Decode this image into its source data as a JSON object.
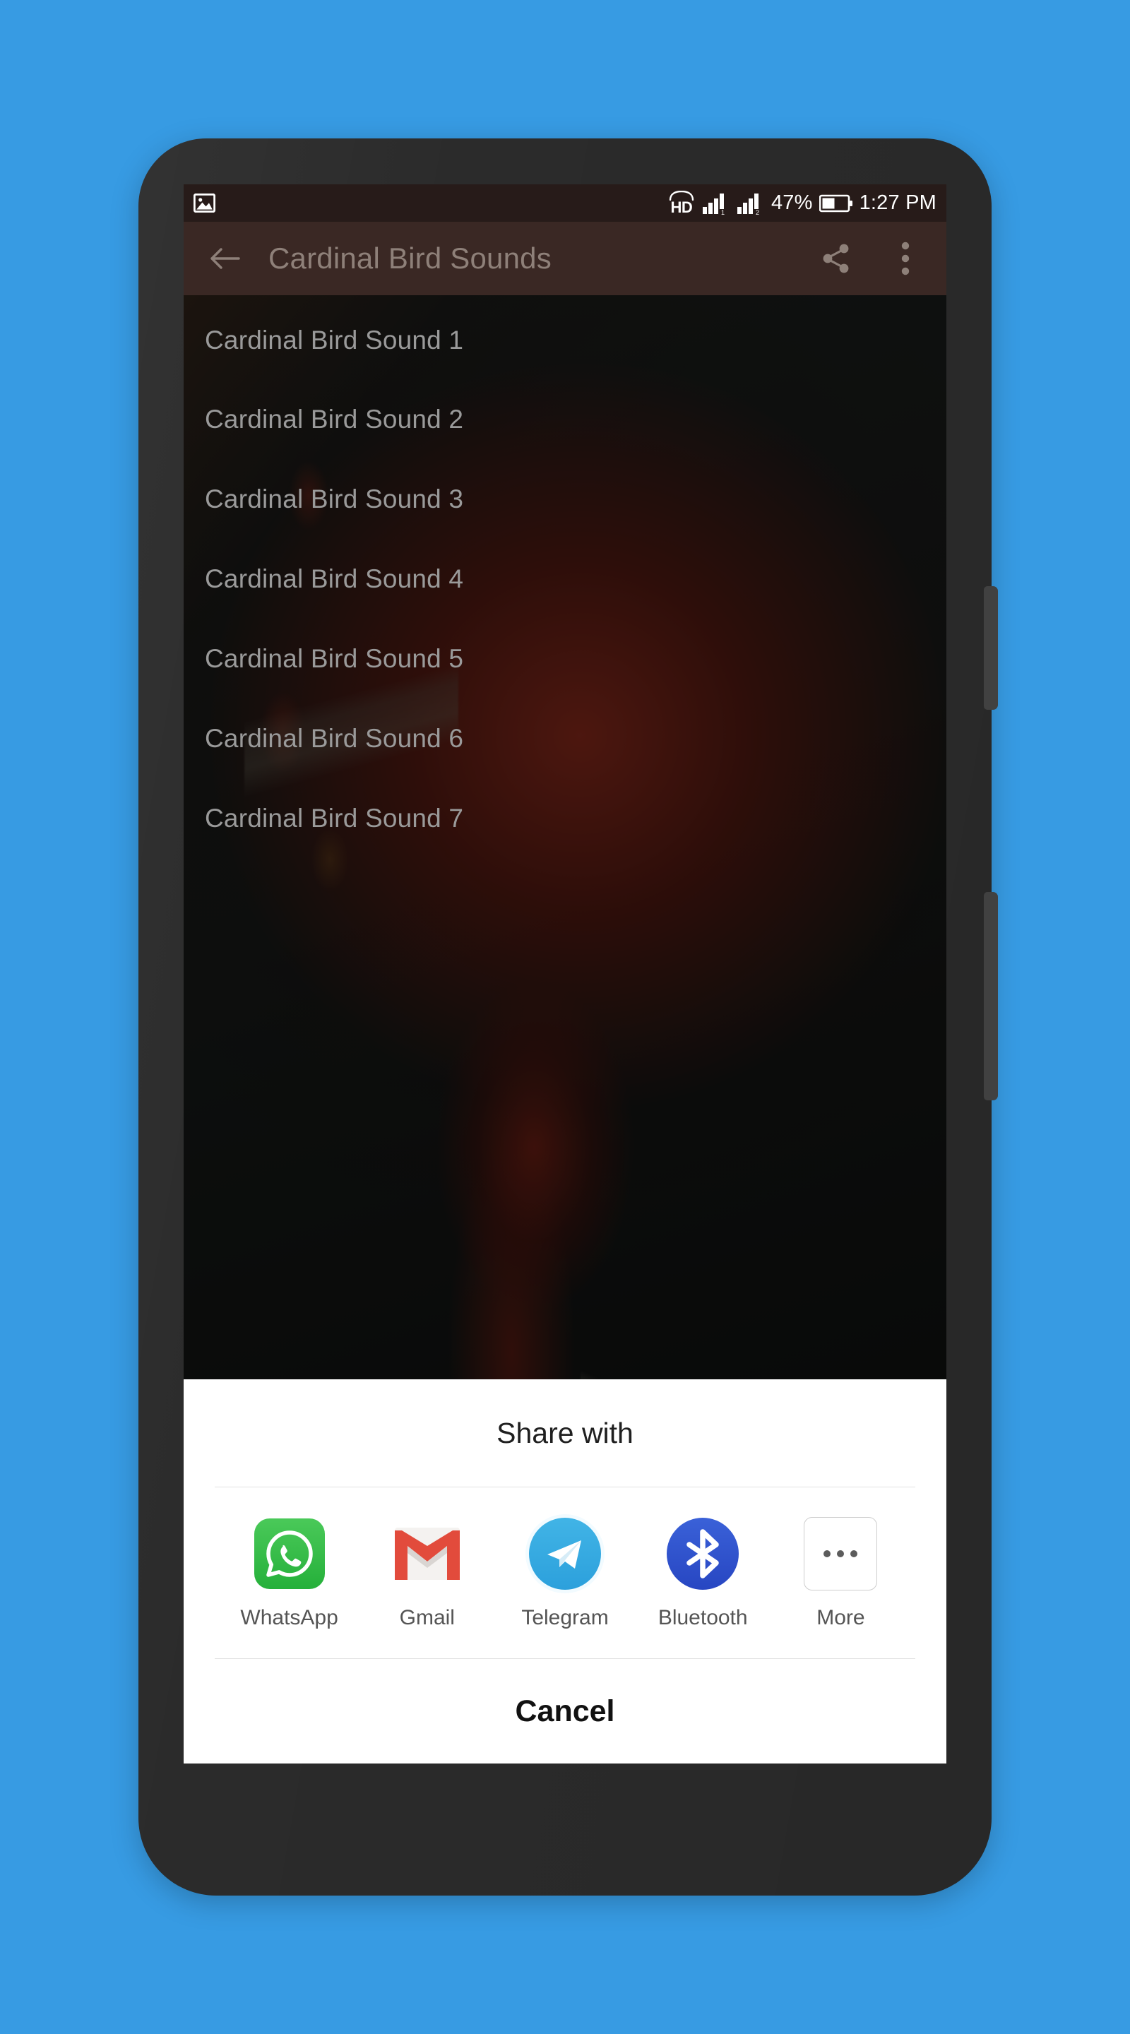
{
  "background": {
    "color": "#379BE3"
  },
  "device": {
    "body_color": "#2B2B2B",
    "camera_icon": "front-camera-icon",
    "speaker_icon": "ear-speaker-icon",
    "sensor_icon": "proximity-sensor-icon",
    "volume_button": "volume-rocker",
    "power_button": "power-button"
  },
  "status_bar": {
    "background": "#271B19",
    "notification_icon": "gallery-image-icon",
    "volte_label": "HD",
    "signal_1_icon": "signal-bars-sim1-icon",
    "signal_2_icon": "signal-bars-sim2-icon",
    "battery_percent": "47%",
    "battery_icon": "battery-half-icon",
    "time": "1:27 PM"
  },
  "action_bar": {
    "background": "#3A2824",
    "back_icon": "back-arrow-icon",
    "title": "Cardinal Bird Sounds",
    "share_icon": "share-icon",
    "overflow_icon": "overflow-menu-icon"
  },
  "content": {
    "scrim_opacity": "0.62",
    "items": [
      {
        "label": "Cardinal Bird Sound 1"
      },
      {
        "label": "Cardinal Bird Sound 2"
      },
      {
        "label": "Cardinal Bird Sound 3"
      },
      {
        "label": "Cardinal Bird Sound 4"
      },
      {
        "label": "Cardinal Bird Sound 5"
      },
      {
        "label": "Cardinal Bird Sound 6"
      },
      {
        "label": "Cardinal Bird Sound 7"
      }
    ]
  },
  "share_sheet": {
    "title": "Share with",
    "cancel_label": "Cancel",
    "apps": [
      {
        "label": "WhatsApp",
        "icon": "whatsapp-icon",
        "color": "#25B03A"
      },
      {
        "label": "Gmail",
        "icon": "gmail-icon",
        "color": "#E5403A"
      },
      {
        "label": "Telegram",
        "icon": "telegram-icon",
        "color": "#2CA0DC"
      },
      {
        "label": "Bluetooth",
        "icon": "bluetooth-icon",
        "color": "#2746C2"
      },
      {
        "label": "More",
        "icon": "more-dots-icon",
        "color": "#5C5C5C"
      }
    ]
  }
}
